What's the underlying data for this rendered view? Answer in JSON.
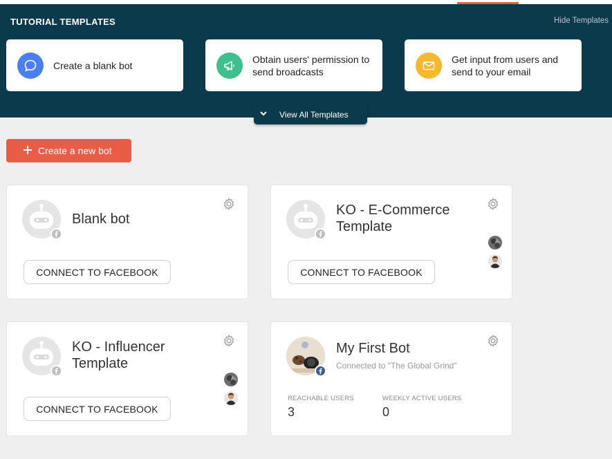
{
  "banner": {
    "title": "TUTORIAL TEMPLATES",
    "hide_link": "Hide Templates",
    "view_all": "View All Templates",
    "templates": [
      {
        "label": "Create a blank bot",
        "icon": "chat-bubble-icon",
        "color": "#4a7ff0"
      },
      {
        "label": "Obtain users' permission to send broadcasts",
        "icon": "megaphone-icon",
        "color": "#3fbf8e"
      },
      {
        "label": "Get input from users and send to your email",
        "icon": "envelope-icon",
        "color": "#f5b82e"
      }
    ]
  },
  "actions": {
    "new_bot": "Create a new bot"
  },
  "bots": [
    {
      "name": "Blank bot",
      "button": "CONNECT TO FACEBOOK"
    },
    {
      "name": "KO - E-Commerce Template",
      "button": "CONNECT TO FACEBOOK"
    },
    {
      "name": "KO - Influencer Template",
      "button": "CONNECT TO FACEBOOK"
    },
    {
      "name": "My First Bot",
      "connected": "Connected to \"The Global Grind\"",
      "reachable_label": "REACHABLE USERS",
      "reachable_value": "3",
      "weekly_label": "WEEKLY ACTIVE USERS",
      "weekly_value": "0"
    }
  ],
  "colors": {
    "accent": "#e95c45",
    "banner": "#0b3a4c",
    "facebook": "#3b5998"
  }
}
